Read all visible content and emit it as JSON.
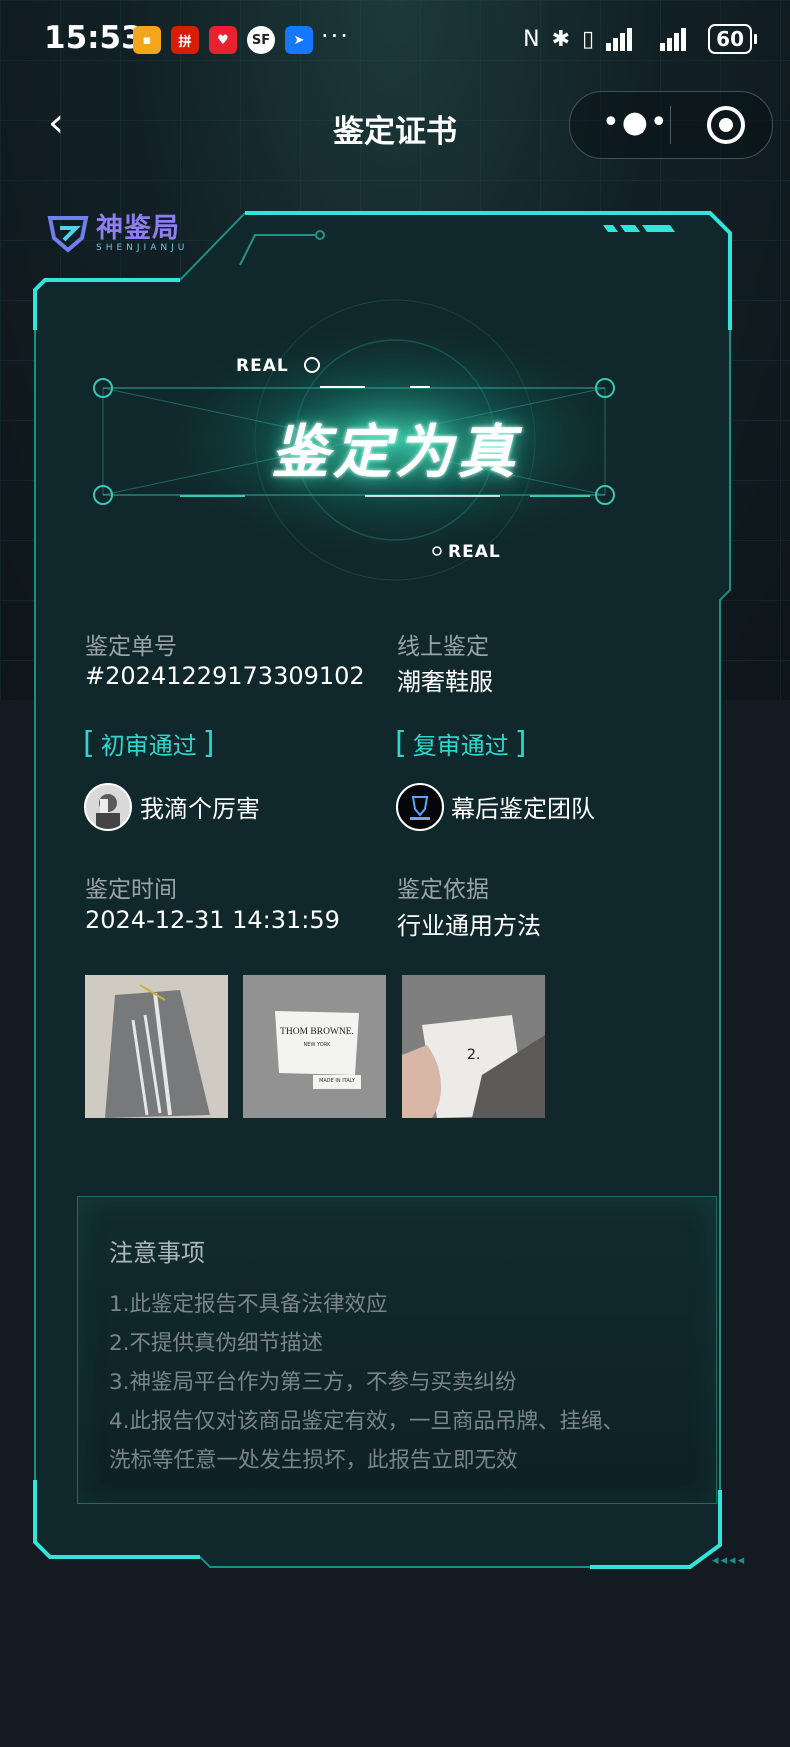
{
  "status_bar": {
    "time": "15:53",
    "app_icons": [
      "weather-icon",
      "pinduoduo-icon",
      "taobao-icon",
      "sf-express-icon",
      "navigation-icon"
    ],
    "more": "···",
    "battery": "60"
  },
  "nav": {
    "back": "‹",
    "title": "鉴定证书",
    "capsule_menu": "•●•"
  },
  "brand": {
    "name": "神鉴局",
    "pinyin": "SHENJIANJU"
  },
  "banner": {
    "real_top": "REAL",
    "verdict": "鉴定为真",
    "real_bottom": "REAL"
  },
  "info": {
    "order_label": "鉴定单号",
    "order_value": "#20241229173309102",
    "type_label": "线上鉴定",
    "type_value": "潮奢鞋服",
    "first_review_tag": "初审通过",
    "first_reviewer": "我滴个厉害",
    "second_review_tag": "复审通过",
    "second_reviewer": "幕后鉴定团队",
    "time_label": "鉴定时间",
    "time_value": "2024-12-31 14:31:59",
    "basis_label": "鉴定依据",
    "basis_value": "行业通用方法"
  },
  "photos": {
    "label_brand": "THOM BROWNE.",
    "label_city": "NEW YORK",
    "label_made": "MADE IN ITALY"
  },
  "notice": {
    "title": "注意事项",
    "items": [
      "1.此鉴定报告不具备法律效应",
      "2.不提供真伪细节描述",
      "3.神鉴局平台作为第三方，不参与买卖纠纷",
      "4.此报告仅对该商品鉴定有效，一旦商品吊牌、挂绳、",
      "洗标等任意一处发生损坏，此报告立即无效"
    ]
  },
  "colors": {
    "accent": "#2ed6d0",
    "background": "#141a22",
    "card": "#10282b"
  }
}
